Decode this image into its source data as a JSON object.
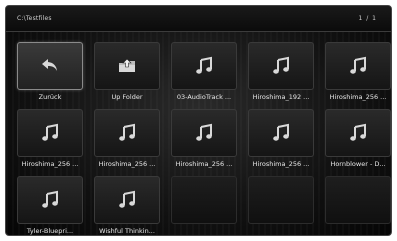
{
  "header": {
    "path": "C:\\Testfiles",
    "page_indicator": "1 / 1"
  },
  "items": [
    {
      "label": "Zurück",
      "icon": "back-arrow-icon"
    },
    {
      "label": "Up Folder",
      "icon": "up-folder-icon"
    },
    {
      "label": "03-AudioTrack ...",
      "icon": "music-note-icon"
    },
    {
      "label": "Hiroshima_192 ...",
      "icon": "music-note-icon"
    },
    {
      "label": "Hiroshima_256 ...",
      "icon": "music-note-icon"
    },
    {
      "label": "Hiroshima_256 ...",
      "icon": "music-note-icon"
    },
    {
      "label": "Hiroshima_256 ...",
      "icon": "music-note-icon"
    },
    {
      "label": "Hiroshima_256 ...",
      "icon": "music-note-icon"
    },
    {
      "label": "Hiroshima_256 ...",
      "icon": "music-note-icon"
    },
    {
      "label": "Hornblower - D...",
      "icon": "music-note-icon"
    },
    {
      "label": "Tyler-Bluepri...",
      "icon": "music-note-icon"
    },
    {
      "label": "Wishful Thinkin...",
      "icon": "music-note-icon"
    }
  ],
  "empty_tiles": 3,
  "colors": {
    "background": "#111111",
    "text": "#e8e8e8",
    "icon": "#d8d8d8"
  }
}
